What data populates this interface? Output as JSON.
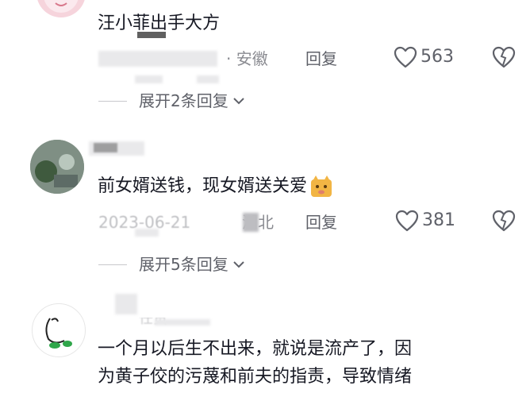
{
  "comments": [
    {
      "text": "汪小菲出手大方",
      "location": "· 安徽",
      "reply_label": "回复",
      "like_count": "563",
      "expand_label": "展开2条回复"
    },
    {
      "text": "前女婿送钱，现女婿送关爱",
      "date": "2023-06-21",
      "location": "湖北",
      "reply_label": "回复",
      "like_count": "381",
      "expand_label": "展开5条回复"
    },
    {
      "username": "任贸",
      "text_line1": "一个月以后生不出来，就说是流产了，因",
      "text_line2": "为黄子佼的污蔑和前夫的指责，导致情绪"
    }
  ],
  "colors": {
    "text": "#161823",
    "meta": "#8a8b91",
    "expand": "#5f6169"
  }
}
